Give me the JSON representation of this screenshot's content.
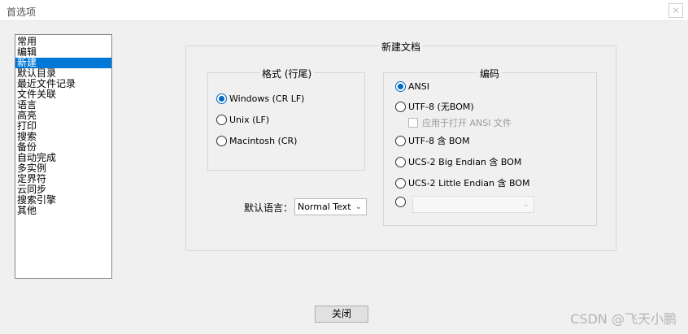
{
  "window": {
    "title": "首选项",
    "close_glyph": "×"
  },
  "sidebar": {
    "items": [
      {
        "label": "常用"
      },
      {
        "label": "编辑"
      },
      {
        "label": "新建"
      },
      {
        "label": "默认目录"
      },
      {
        "label": "最近文件记录"
      },
      {
        "label": "文件关联"
      },
      {
        "label": "语言"
      },
      {
        "label": "高亮"
      },
      {
        "label": "打印"
      },
      {
        "label": "搜索"
      },
      {
        "label": "备份"
      },
      {
        "label": "自动完成"
      },
      {
        "label": "多实例"
      },
      {
        "label": "定界符"
      },
      {
        "label": "云同步"
      },
      {
        "label": "搜索引擎"
      },
      {
        "label": "其他"
      }
    ],
    "selected": "新建"
  },
  "new_doc": {
    "title": "新建文档",
    "format": {
      "title": "格式 (行尾)",
      "options": [
        "Windows (CR LF)",
        "Unix (LF)",
        "Macintosh (CR)"
      ],
      "selected": "Windows (CR LF)"
    },
    "default_language": {
      "label": "默认语言：",
      "value": "Normal Text"
    },
    "encoding": {
      "title": "编码",
      "ansi": "ANSI",
      "utf8_no_bom": "UTF-8 (无BOM)",
      "apply_ansi": "应用于打开 ANSI 文件",
      "utf8_bom": "UTF-8 含 BOM",
      "ucs2_be": "UCS-2 Big Endian 含 BOM",
      "ucs2_le": "UCS-2 Little Endian 含 BOM",
      "other_value": "",
      "selected": "ANSI"
    }
  },
  "close_button": "关闭",
  "watermark": "CSDN @飞天小鹏",
  "colors": {
    "selection": "#0078d7",
    "radio_accent": "#0067c0"
  }
}
